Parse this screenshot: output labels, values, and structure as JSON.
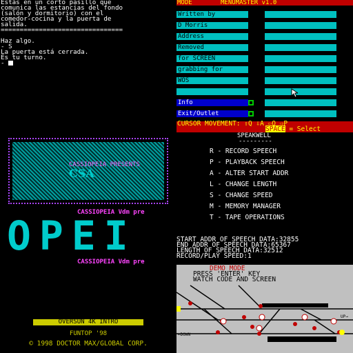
{
  "adventure": {
    "lines": [
      "Estás en un corto pasillo que",
      "comunica las estancias del fondo",
      "(salón y dormitorio) con el",
      "comedor-cocina y la puerta de",
      "salida.",
      "================================",
      "",
      "Haz algo.",
      "- S",
      "La puerta está cerrada.",
      "Es tu turno.",
      "- "
    ]
  },
  "menumaster": {
    "header": [
      "MODE",
      "MENUMASTER v1.0"
    ],
    "rows": [
      {
        "label": "Written by"
      },
      {
        "label": "D Morris"
      },
      {
        "label": "Address"
      },
      {
        "label": "Removed"
      },
      {
        "label": "for SCREEN"
      },
      {
        "label": "grabbing for"
      },
      {
        "label": "WOS"
      },
      {
        "label": ""
      },
      {
        "label": "Info"
      },
      {
        "label": "Exit/Outlet"
      }
    ],
    "footer_line1": "CURSOR MOVEMENT: ⇧Q ⇩A ⇦O ⇨P",
    "footer_space": "SPACE",
    "footer_select": "= Select"
  },
  "demo": {
    "present_text": "CASSIOPEIA PRESENTS",
    "logo_text": "CSA",
    "cassio_line": "CASSIOPEIA Vdm pre",
    "big_letters": [
      "O",
      "P",
      "E",
      "I"
    ],
    "oversun": "OVERSUN 4K INTRO",
    "funtop": "FUNTOP '98",
    "copyright": "© 1998 DOCTOR MAX/GLOBAL CORP."
  },
  "speakwell": {
    "title": "SPEAKWELL",
    "underline": "---------",
    "menu": [
      "R - RECORD SPEECH",
      "P - PLAYBACK SPEECH",
      "A - ALTER START ADDR",
      "L - CHANGE LENGTH",
      "S - CHANGE SPEED",
      "M - MEMORY MANAGER",
      "T - TAPE OPERATIONS"
    ],
    "stats": [
      "START ADDR OF SPEECH DATA:32855",
      "END ADDR OF SPEECH DATA:65367",
      "LENGTH OF SPEECH DATA:32512",
      "RECORD/PLAY SPEED:1"
    ]
  },
  "map": {
    "demo_mode": "DEMO MODE",
    "press": "PRESS 'ENTER' KEY",
    "watch": "WATCH CODE AND SCREEN",
    "up_label": "UP→",
    "down_label": "←DOWN"
  }
}
